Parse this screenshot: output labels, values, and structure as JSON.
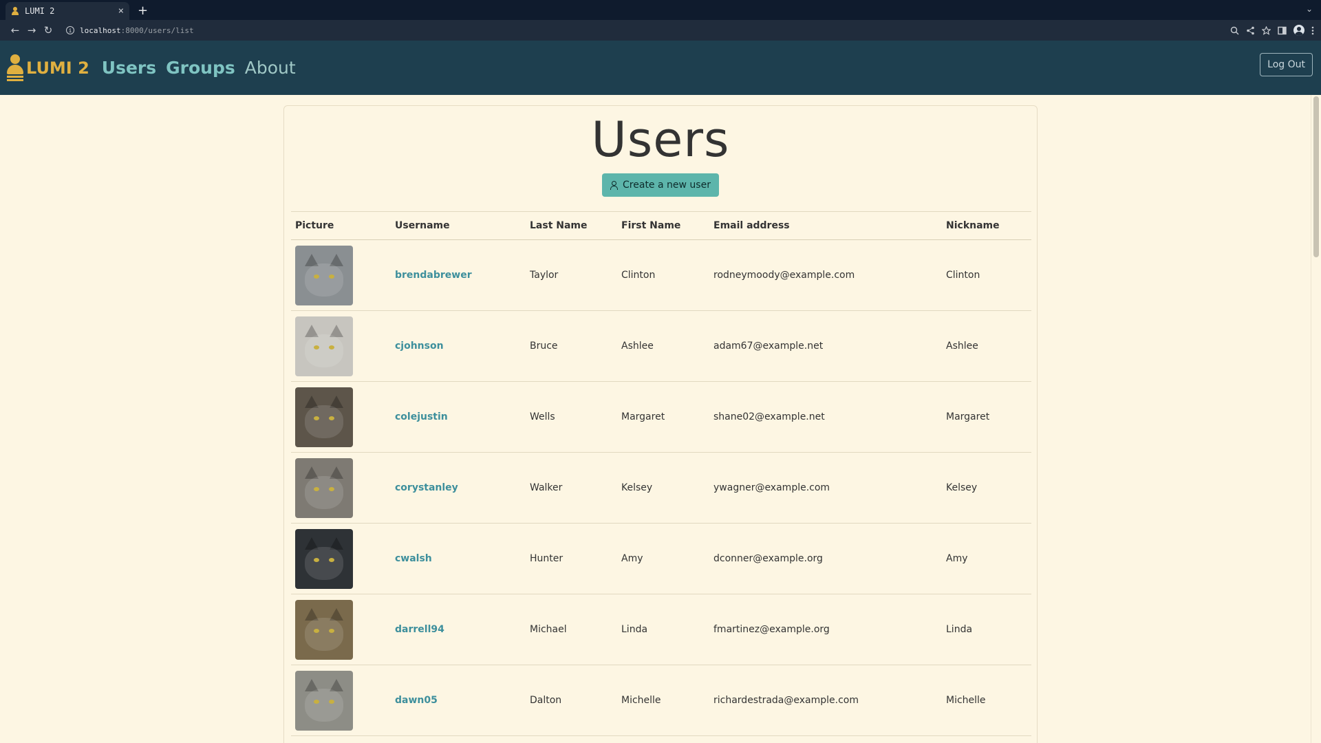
{
  "browser": {
    "tab_title": "LUMI 2",
    "tab_close": "×",
    "new_tab": "+",
    "overflow": "⌄",
    "url_host": "localhost",
    "url_path": ":8000/users/list",
    "back": "←",
    "forward": "→",
    "reload": "↻"
  },
  "navbar": {
    "brand": "LUMI 2",
    "links": [
      "Users",
      "Groups",
      "About"
    ],
    "logout": "Log Out"
  },
  "page": {
    "title": "Users",
    "create_button": "Create a new user"
  },
  "table": {
    "headers": [
      "Picture",
      "Username",
      "Last Name",
      "First Name",
      "Email address",
      "Nickname"
    ],
    "rows": [
      {
        "username": "brendabrewer",
        "last": "Taylor",
        "first": "Clinton",
        "email": "rodneymoody@example.com",
        "nickname": "Clinton",
        "color": "#8a8f92"
      },
      {
        "username": "cjohnson",
        "last": "Bruce",
        "first": "Ashlee",
        "email": "adam67@example.net",
        "nickname": "Ashlee",
        "color": "#c7c5bf"
      },
      {
        "username": "colejustin",
        "last": "Wells",
        "first": "Margaret",
        "email": "shane02@example.net",
        "nickname": "Margaret",
        "color": "#5d554a"
      },
      {
        "username": "corystanley",
        "last": "Walker",
        "first": "Kelsey",
        "email": "ywagner@example.com",
        "nickname": "Kelsey",
        "color": "#7e7a73"
      },
      {
        "username": "cwalsh",
        "last": "Hunter",
        "first": "Amy",
        "email": "dconner@example.org",
        "nickname": "Amy",
        "color": "#2e3236"
      },
      {
        "username": "darrell94",
        "last": "Michael",
        "first": "Linda",
        "email": "fmartinez@example.org",
        "nickname": "Linda",
        "color": "#7a6a4c"
      },
      {
        "username": "dawn05",
        "last": "Dalton",
        "first": "Michelle",
        "email": "richardestrada@example.com",
        "nickname": "Michelle",
        "color": "#8d8d86"
      }
    ]
  }
}
